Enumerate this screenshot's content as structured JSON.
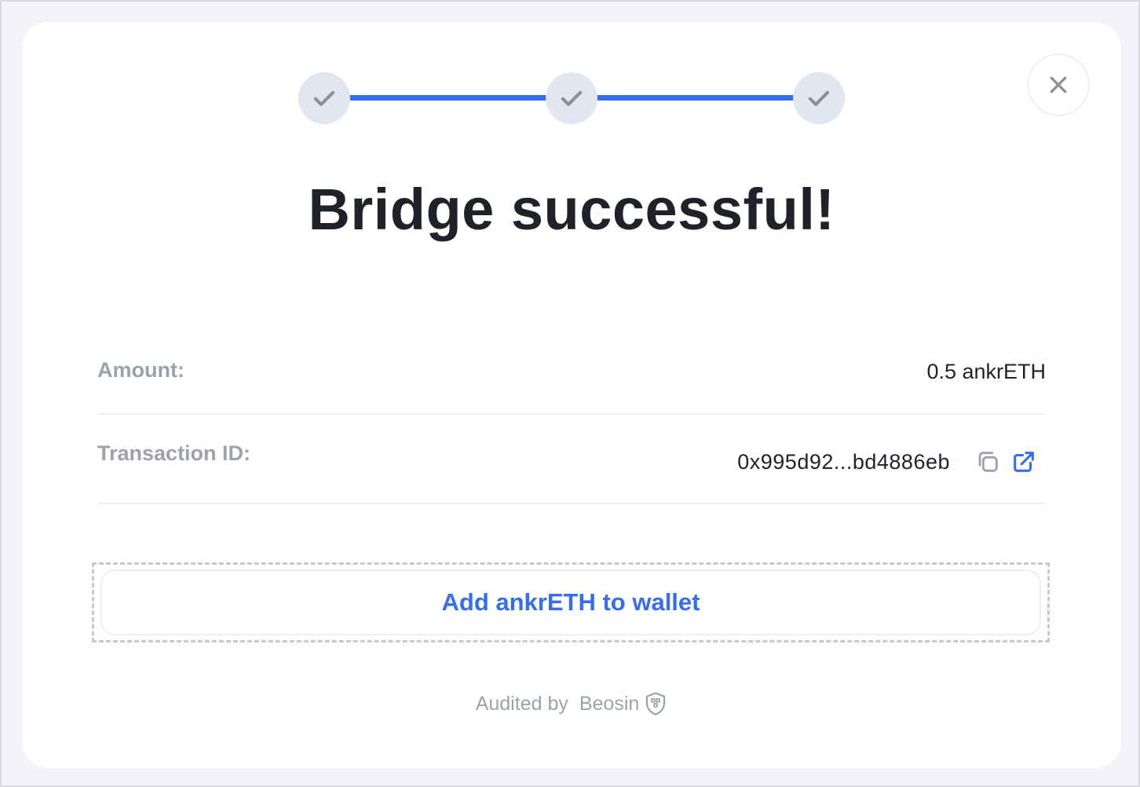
{
  "stepper": {
    "steps": [
      {
        "state": "completed",
        "icon": "check-icon"
      },
      {
        "state": "completed",
        "icon": "check-icon"
      },
      {
        "state": "completed",
        "icon": "check-icon"
      }
    ],
    "active_color": "#356df3"
  },
  "close": {
    "icon": "close-icon"
  },
  "title": "Bridge successful!",
  "details": {
    "amount_label": "Amount:",
    "amount_value": "0.5 ankrETH",
    "tx_label": "Transaction ID:",
    "tx_value": "0x995d92...bd4886eb",
    "copy_icon": "copy-icon",
    "external_icon": "external-link-icon"
  },
  "add_wallet": {
    "label": "Add ankrETH to wallet",
    "color": "#356df3"
  },
  "footer": {
    "audited_by": "Audited by",
    "auditor": "Beosin",
    "auditor_icon": "shield-logo-icon"
  }
}
